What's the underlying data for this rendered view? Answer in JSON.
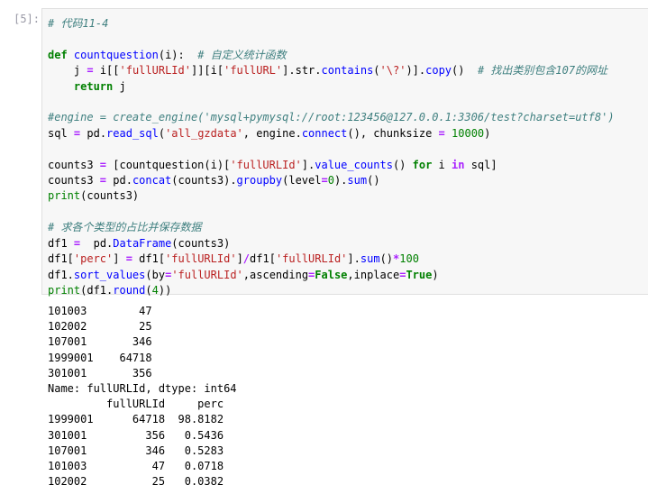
{
  "cell": {
    "prompt": "[5]:",
    "code": {
      "l1_comment": "# 代码11-4",
      "l2_def": "def",
      "l2_fname": "countquestion",
      "l2_args": "(i):  ",
      "l2_comment": "# 自定义统计函数",
      "l3_indent": "    j ",
      "l3_eq": "=",
      "l3_a": " i[[",
      "l3_s1": "'fullURLId'",
      "l3_b": "]][i[",
      "l3_s2": "'fullURL'",
      "l3_c": "].str.",
      "l3_contains": "contains",
      "l3_d": "(",
      "l3_s3": "'\\?'",
      "l3_e": ")].",
      "l3_copy": "copy",
      "l3_f": "()  ",
      "l3_comment": "# 找出类别包含107的网址",
      "l4_indent": "    ",
      "l4_return": "return",
      "l4_rest": " j",
      "l6_comment": "#engine = create_engine('mysql+pymysql://root:123456@127.0.0.1:3306/test?charset=utf8')",
      "l7_a": "sql ",
      "l7_eq": "=",
      "l7_b": " pd.",
      "l7_fn": "read_sql",
      "l7_c": "(",
      "l7_s": "'all_gzdata'",
      "l7_d": ", engine.",
      "l7_connect": "connect",
      "l7_e": "(), chunksize ",
      "l7_eq2": "=",
      "l7_sp": " ",
      "l7_num": "10000",
      "l7_f": ")",
      "l9_a": "counts3 ",
      "l9_eq": "=",
      "l9_b": " [countquestion(i)[",
      "l9_s": "'fullURLId'",
      "l9_c": "].",
      "l9_fn": "value_counts",
      "l9_d": "() ",
      "l9_for": "for",
      "l9_e": " i ",
      "l9_in": "in",
      "l9_f": " sql]",
      "l10_a": "counts3 ",
      "l10_eq": "=",
      "l10_b": " pd.",
      "l10_concat": "concat",
      "l10_c": "(counts3).",
      "l10_groupby": "groupby",
      "l10_d": "(level",
      "l10_eq2": "=",
      "l10_num": "0",
      "l10_e": ").",
      "l10_sum": "sum",
      "l10_f": "()",
      "l11_print": "print",
      "l11_rest": "(counts3)",
      "l13_comment": "# 求各个类型的占比并保存数据",
      "l14_a": "df1 ",
      "l14_eq": "=",
      "l14_b": "  pd.",
      "l14_fn": "DataFrame",
      "l14_c": "(counts3)",
      "l15_a": "df1[",
      "l15_s1": "'perc'",
      "l15_b": "] ",
      "l15_eq": "=",
      "l15_c": " df1[",
      "l15_s2": "'fullURLId'",
      "l15_d": "]",
      "l15_slash": "/",
      "l15_e": "df1[",
      "l15_s3": "'fullURLId'",
      "l15_f": "].",
      "l15_sum": "sum",
      "l15_g": "()",
      "l15_mul": "*",
      "l15_num": "100",
      "l16_a": "df1.",
      "l16_fn": "sort_values",
      "l16_b": "(by",
      "l16_eq": "=",
      "l16_s": "'fullURLId'",
      "l16_c": ",ascending",
      "l16_eq2": "=",
      "l16_false": "False",
      "l16_d": ",inplace",
      "l16_eq3": "=",
      "l16_true": "True",
      "l16_e": ")",
      "l17_print": "print",
      "l17_a": "(df1.",
      "l17_round": "round",
      "l17_b": "(",
      "l17_num": "4",
      "l17_c": "))"
    },
    "output_lines": [
      "101003        47",
      "102002        25",
      "107001       346",
      "1999001    64718",
      "301001       356",
      "Name: fullURLId, dtype: int64",
      "         fullURLId     perc",
      "1999001      64718  98.8182",
      "301001         356   0.5436",
      "107001         346   0.5283",
      "101003          47   0.0718",
      "102002          25   0.0382"
    ]
  }
}
